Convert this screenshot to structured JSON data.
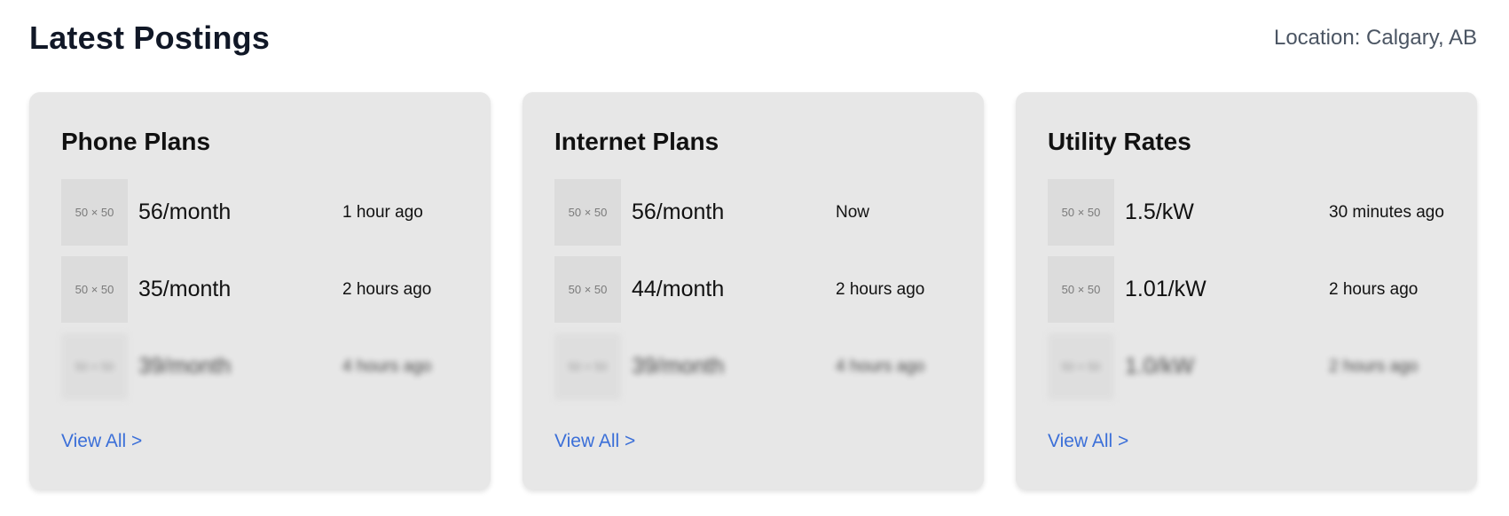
{
  "header": {
    "title": "Latest Postings",
    "location": "Location: Calgary, AB"
  },
  "cards": [
    {
      "title": "Phone Plans",
      "rows": [
        {
          "thumb": "50 × 50",
          "price": "56/month",
          "time": "1 hour ago"
        },
        {
          "thumb": "50 × 50",
          "price": "35/month",
          "time": "2 hours ago"
        },
        {
          "thumb": "50 × 50",
          "price": "39/month",
          "time": "4 hours ago"
        }
      ],
      "view_all": "View All >"
    },
    {
      "title": "Internet Plans",
      "rows": [
        {
          "thumb": "50 × 50",
          "price": "56/month",
          "time": "Now"
        },
        {
          "thumb": "50 × 50",
          "price": "44/month",
          "time": "2 hours ago"
        },
        {
          "thumb": "50 × 50",
          "price": "39/month",
          "time": "4 hours ago"
        }
      ],
      "view_all": "View All >"
    },
    {
      "title": "Utility Rates",
      "rows": [
        {
          "thumb": "50 × 50",
          "price": "1.5/kW",
          "time": "30 minutes ago"
        },
        {
          "thumb": "50 × 50",
          "price": "1.01/kW",
          "time": "2 hours ago"
        },
        {
          "thumb": "50 × 50",
          "price": "1.0/kW",
          "time": "2 hours ago"
        }
      ],
      "view_all": "View All >"
    }
  ],
  "colors": {
    "card_bg": "#e7e7e7",
    "link": "#3b6fd8",
    "location_text": "#4b5563"
  }
}
